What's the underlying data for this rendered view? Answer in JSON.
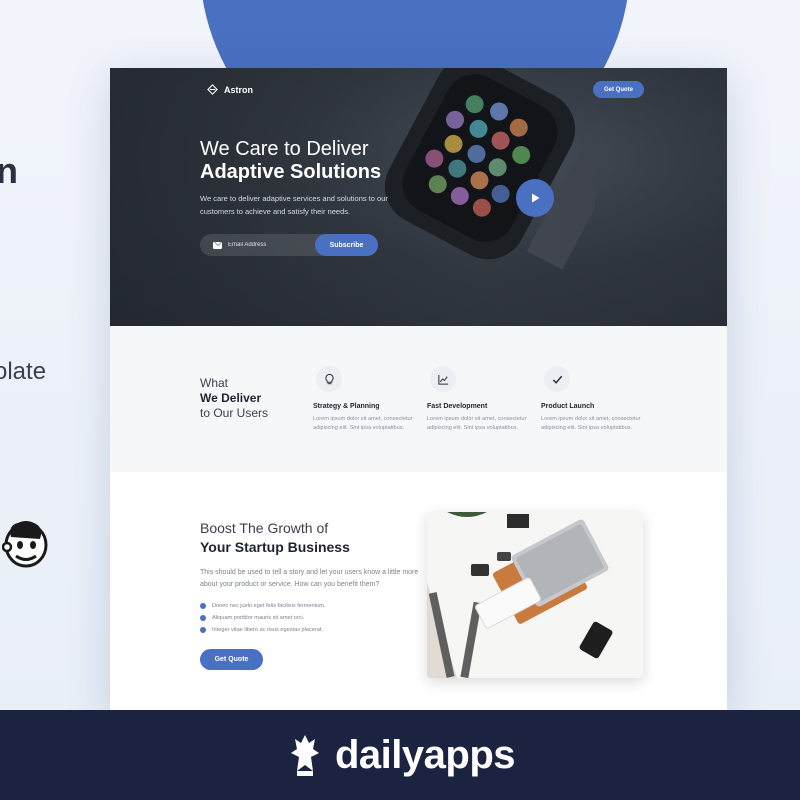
{
  "side": {
    "frag_top": "n",
    "frag_mid": "olate"
  },
  "hero": {
    "brand": "Astron",
    "get_quote_label": "Get Quote",
    "title_line1": "We Care to Deliver",
    "title_line2": "Adaptive Solutions",
    "description": "We care to deliver adaptive services and solutions to our customers to achieve and satisfy their needs.",
    "email_placeholder": "Email Address",
    "subscribe_label": "Subscribe"
  },
  "features": {
    "heading_line1": "What",
    "heading_line2": "We Deliver",
    "heading_line3": "to Our Users",
    "items": [
      {
        "icon": "lightbulb-icon",
        "title": "Strategy & Planning",
        "desc": "Lorem ipsum dolor sit amet, consectetur adipiscing elit. Sint ipsa voluptatibus."
      },
      {
        "icon": "chart-icon",
        "title": "Fast Development",
        "desc": "Lorem ipsum dolor sit amet, consectetur adipiscing elit. Sint ipsa voluptatibus."
      },
      {
        "icon": "checkmark-icon",
        "title": "Product Launch",
        "desc": "Lorem ipsum dolor sit amet, consectetur adipiscing elit. Sint ipsa voluptatibus."
      }
    ]
  },
  "growth": {
    "title_line1": "Boost The Growth of",
    "title_line2": "Your Startup Business",
    "description": "This should be used to tell a story and let your users know a little more about your product or service. How can you benefit them?",
    "list": [
      "Donec nec justo eget felis facilisis fermentum.",
      "Aliquam porttitor mauris sit amet orci.",
      "Integer vitae libero ac risus egestas placerat."
    ],
    "get_quote_label": "Get Quote"
  },
  "footer": {
    "brand": "dailyapps"
  },
  "colors": {
    "accent": "#4a70c2",
    "footer_bg": "#1b2340",
    "hero_bg": "#2f353e"
  }
}
